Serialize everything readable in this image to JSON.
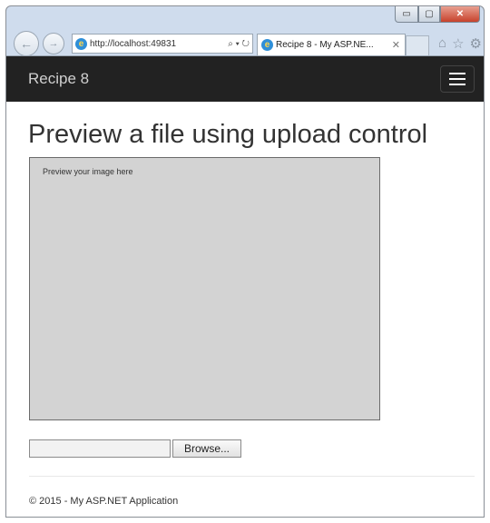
{
  "browser": {
    "window_controls": {
      "minimize": "▭",
      "maximize": "▢",
      "close": "✕"
    },
    "address": "http://localhost:49831",
    "address_tools": "⌕ ▾ ↻",
    "tab_title": "Recipe 8 - My ASP.NE...",
    "tab_close": "✕",
    "icons": [
      "back-icon",
      "forward-icon",
      "ie-icon",
      "search-icon",
      "refresh-icon",
      "home-icon",
      "favorites-icon",
      "settings-icon"
    ]
  },
  "navbar": {
    "brand": "Recipe 8",
    "toggle_icon": "hamburger-menu-icon"
  },
  "main": {
    "heading": "Preview a file using upload control",
    "preview_text": "Preview your image here",
    "file_input_value": "",
    "browse_label": "Browse..."
  },
  "footer": {
    "text": "© 2015 - My ASP.NET Application"
  },
  "colors": {
    "navbar_bg": "#222222",
    "preview_bg": "#d3d3d3",
    "close_button": "#c7422c"
  }
}
